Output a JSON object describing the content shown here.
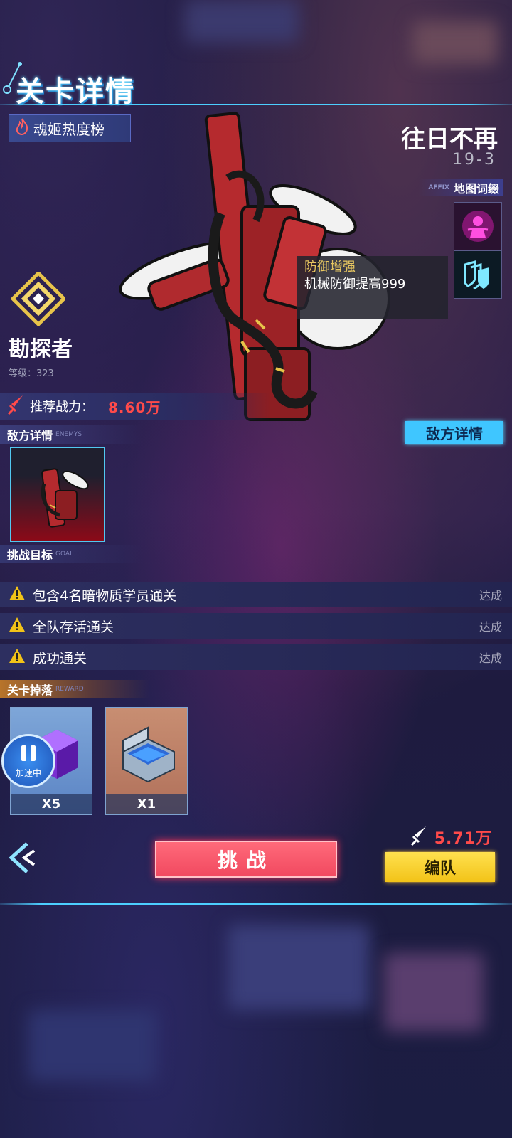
{
  "header": {
    "title": "关卡详情"
  },
  "ranking_button": {
    "label": "魂姬热度榜"
  },
  "stage": {
    "name": "往日不再",
    "number": "19-3"
  },
  "affix": {
    "label": "地图词缀",
    "label_en": "AFFIX",
    "icons": [
      "doll-curse-icon",
      "defense-shield-icon"
    ]
  },
  "tooltip": {
    "title": "防御增强",
    "text": "机械防御提高999"
  },
  "boss": {
    "name": "勘探者",
    "level": "等级：323"
  },
  "recommended_power": {
    "label": "推荐战力：",
    "value": "8.60万"
  },
  "enemy_section": {
    "title": "敌方详情",
    "title_en": "ENEMYS",
    "button_label": "敌方详情"
  },
  "goals_section": {
    "title": "挑战目标",
    "title_en": "GOAL",
    "items": [
      {
        "text": "包含4名暗物质学员通关",
        "status": "达成"
      },
      {
        "text": "全队存活通关",
        "status": "达成"
      },
      {
        "text": "成功通关",
        "status": "达成"
      }
    ]
  },
  "reward_section": {
    "title": "关卡掉落",
    "title_en": "REWARD",
    "items": [
      {
        "name": "purple-cube-item",
        "qty": "X5"
      },
      {
        "name": "supply-case-item",
        "qty": "X1"
      }
    ]
  },
  "speed_button": {
    "label": "加速中"
  },
  "challenge_button": {
    "label": "挑战"
  },
  "team": {
    "power": "5.71万",
    "button_label": "编队"
  },
  "colors": {
    "accent_cyan": "#3fc6ff",
    "power_red": "#ff4a4a",
    "challenge_red": "#f14960",
    "team_yellow": "#f2c318"
  }
}
